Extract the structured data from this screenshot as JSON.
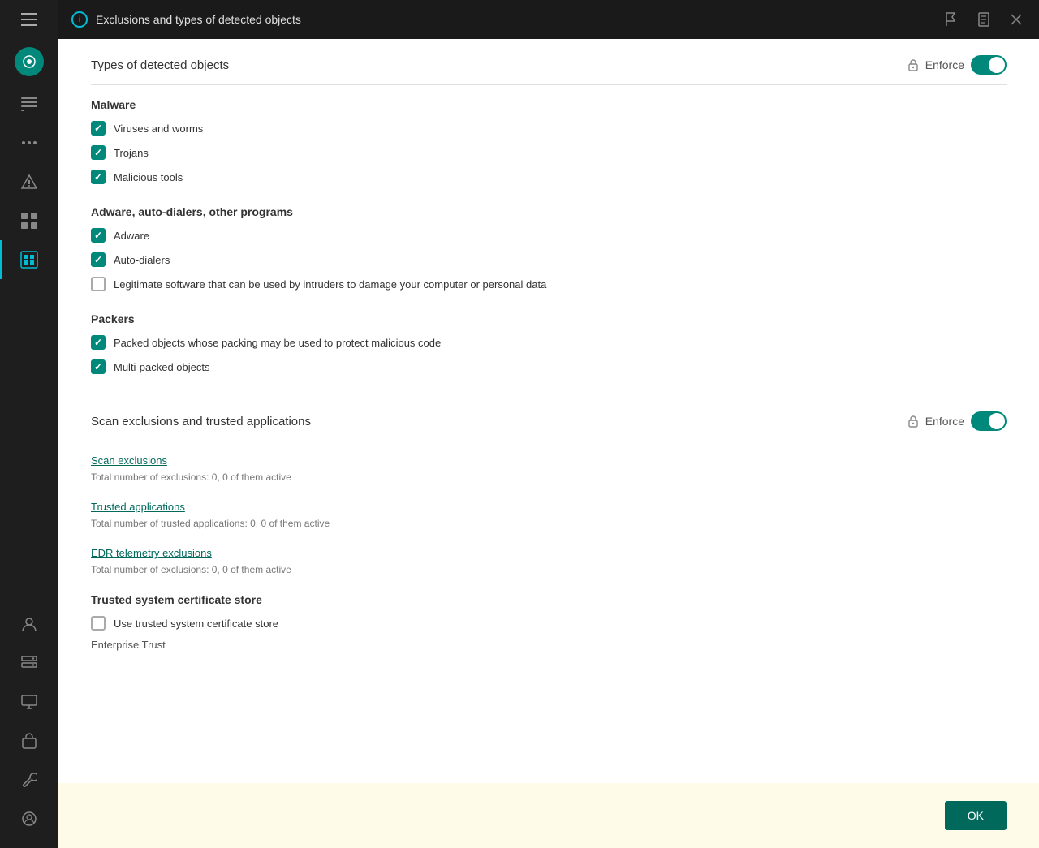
{
  "sidebar": {
    "icons": [
      {
        "name": "hamburger-icon",
        "symbol": "☰"
      },
      {
        "name": "home-icon",
        "symbol": "⌂"
      },
      {
        "name": "list-icon",
        "symbol": "▤"
      },
      {
        "name": "dots-icon",
        "symbol": "⋯"
      },
      {
        "name": "warning-icon",
        "symbol": "△"
      },
      {
        "name": "table-icon",
        "symbol": "⊞"
      },
      {
        "name": "active-item-icon",
        "symbol": "▣"
      },
      {
        "name": "people-icon",
        "symbol": "👤"
      },
      {
        "name": "server-icon",
        "symbol": "▦"
      },
      {
        "name": "monitor-icon",
        "symbol": "⊡"
      },
      {
        "name": "bag-icon",
        "symbol": "⊠"
      },
      {
        "name": "wrench-icon",
        "symbol": "🔧"
      },
      {
        "name": "user-circle-icon",
        "symbol": "⊙"
      }
    ]
  },
  "titlebar": {
    "title": "Exclusions and types of detected objects",
    "icon_symbol": "i"
  },
  "sections": {
    "types_section": {
      "title": "Types of detected objects",
      "enforce_label": "Enforce",
      "toggle_on": true
    },
    "malware": {
      "title": "Malware",
      "items": [
        {
          "label": "Viruses and worms",
          "checked": true
        },
        {
          "label": "Trojans",
          "checked": true
        },
        {
          "label": "Malicious tools",
          "checked": true
        }
      ]
    },
    "adware": {
      "title": "Adware, auto-dialers, other programs",
      "items": [
        {
          "label": "Adware",
          "checked": true
        },
        {
          "label": "Auto-dialers",
          "checked": true
        },
        {
          "label": "Legitimate software that can be used by intruders to damage your computer or personal data",
          "checked": false
        }
      ]
    },
    "packers": {
      "title": "Packers",
      "items": [
        {
          "label": "Packed objects whose packing may be used to protect malicious code",
          "checked": true
        },
        {
          "label": "Multi-packed objects",
          "checked": true
        }
      ]
    },
    "scan_section": {
      "title": "Scan exclusions and trusted applications",
      "enforce_label": "Enforce",
      "toggle_on": true,
      "links": [
        {
          "name": "scan-exclusions-link",
          "label": "Scan exclusions",
          "description": "Total number of exclusions: 0, 0 of them active"
        },
        {
          "name": "trusted-applications-link",
          "label": "Trusted applications",
          "description": "Total number of trusted applications: 0, 0 of them active"
        },
        {
          "name": "edr-telemetry-link",
          "label": "EDR telemetry exclusions",
          "description": "Total number of exclusions: 0, 0 of them active"
        }
      ]
    },
    "cert_section": {
      "title": "Trusted system certificate store",
      "checkbox_label": "Use trusted system certificate store",
      "checked": false,
      "sub_label": "Enterprise Trust"
    }
  },
  "footer": {
    "ok_label": "OK"
  }
}
